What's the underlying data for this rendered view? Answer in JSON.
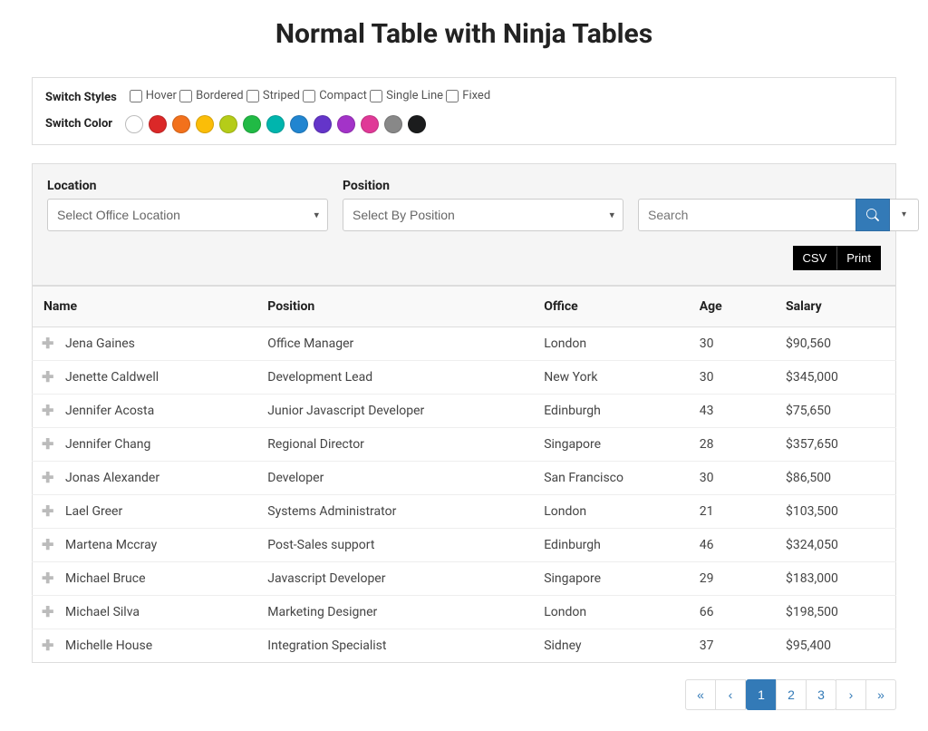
{
  "title": "Normal Table with Ninja Tables",
  "styles": {
    "label": "Switch Styles",
    "options": [
      "Hover",
      "Bordered",
      "Striped",
      "Compact",
      "Single Line",
      "Fixed"
    ]
  },
  "colors": {
    "label": "Switch Color",
    "swatches": [
      "#ffffff",
      "#db2828",
      "#f2711c",
      "#fbbd08",
      "#b5cc18",
      "#21ba45",
      "#00b5ad",
      "#2185d0",
      "#6435c9",
      "#a333c8",
      "#e03997",
      "#888888",
      "#1b1c1d"
    ]
  },
  "filters": {
    "location": {
      "label": "Location",
      "placeholder": "Select Office Location"
    },
    "position": {
      "label": "Position",
      "placeholder": "Select By Position"
    },
    "search_placeholder": "Search"
  },
  "export": {
    "csv": "CSV",
    "print": "Print"
  },
  "table": {
    "headers": [
      "Name",
      "Position",
      "Office",
      "Age",
      "Salary"
    ],
    "rows": [
      {
        "name": "Jena Gaines",
        "position": "Office Manager",
        "office": "London",
        "age": "30",
        "salary": "$90,560"
      },
      {
        "name": "Jenette Caldwell",
        "position": "Development Lead",
        "office": "New York",
        "age": "30",
        "salary": "$345,000"
      },
      {
        "name": "Jennifer Acosta",
        "position": "Junior Javascript Developer",
        "office": "Edinburgh",
        "age": "43",
        "salary": "$75,650"
      },
      {
        "name": "Jennifer Chang",
        "position": "Regional Director",
        "office": "Singapore",
        "age": "28",
        "salary": "$357,650"
      },
      {
        "name": "Jonas Alexander",
        "position": "Developer",
        "office": "San Francisco",
        "age": "30",
        "salary": "$86,500"
      },
      {
        "name": "Lael Greer",
        "position": "Systems Administrator",
        "office": "London",
        "age": "21",
        "salary": "$103,500"
      },
      {
        "name": "Martena Mccray",
        "position": "Post-Sales support",
        "office": "Edinburgh",
        "age": "46",
        "salary": "$324,050"
      },
      {
        "name": "Michael Bruce",
        "position": "Javascript Developer",
        "office": "Singapore",
        "age": "29",
        "salary": "$183,000"
      },
      {
        "name": "Michael Silva",
        "position": "Marketing Designer",
        "office": "London",
        "age": "66",
        "salary": "$198,500"
      },
      {
        "name": "Michelle House",
        "position": "Integration Specialist",
        "office": "Sidney",
        "age": "37",
        "salary": "$95,400"
      }
    ]
  },
  "pagination": {
    "first": "«",
    "prev": "‹",
    "next": "›",
    "last": "»",
    "pages": [
      "1",
      "2",
      "3"
    ],
    "active": "1"
  }
}
